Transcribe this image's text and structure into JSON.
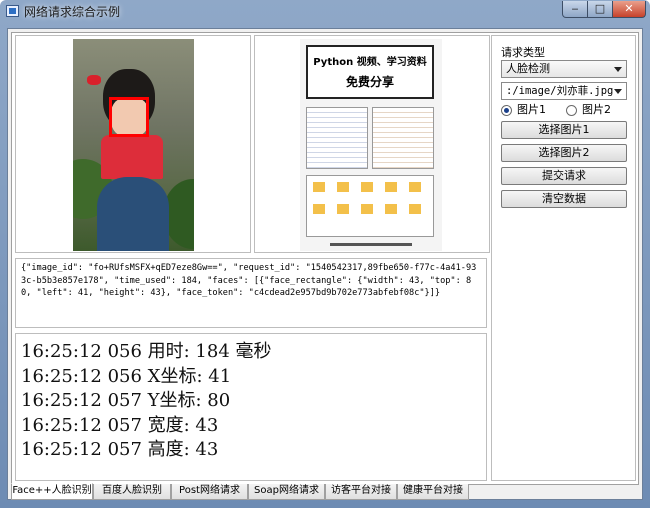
{
  "window": {
    "title": "网络请求综合示例",
    "buttons": {
      "minimize": "‒",
      "maximize": "□",
      "close": "✕"
    }
  },
  "images": {
    "image1_alt": "girl-photo",
    "image2_alt": "poster",
    "poster_title_line1": "Python 视频、学习资料",
    "poster_title_line2": "免费分享"
  },
  "json_result": "{\"image_id\": \"fo+RUfsMSFX+qED7eze8Gw==\", \"request_id\": \"1540542317,89fbe650-f77c-4a41-933c-b5b3e857e178\", \"time_used\": 184, \"faces\": [{\"face_rectangle\": {\"width\": 43, \"top\": 80, \"left\": 41, \"height\": 43}, \"face_token\": \"c4cdead2e957bd9b702e773abfebf08c\"}]}",
  "log": [
    "16:25:12 056  用时: 184 毫秒",
    "16:25:12 056  X坐标: 41",
    "16:25:12 057  Y坐标: 80",
    "16:25:12 057  宽度: 43",
    "16:25:12 057  高度: 43"
  ],
  "controls": {
    "request_type_label": "请求类型",
    "request_type_value": "人脸检测",
    "image_path_value": ":/image/刘亦菲.jpg",
    "radio1_label": "图片1",
    "radio2_label": "图片2",
    "radio_selected": "图片1",
    "btn_select1": "选择图片1",
    "btn_select2": "选择图片2",
    "btn_submit": "提交请求",
    "btn_clear": "清空数据"
  },
  "tabs": [
    "Face++人脸识别",
    "百度人脸识别",
    "Post网络请求",
    "Soap网络请求",
    "访客平台对接",
    "健康平台对接"
  ],
  "active_tab": "Face++人脸识别"
}
